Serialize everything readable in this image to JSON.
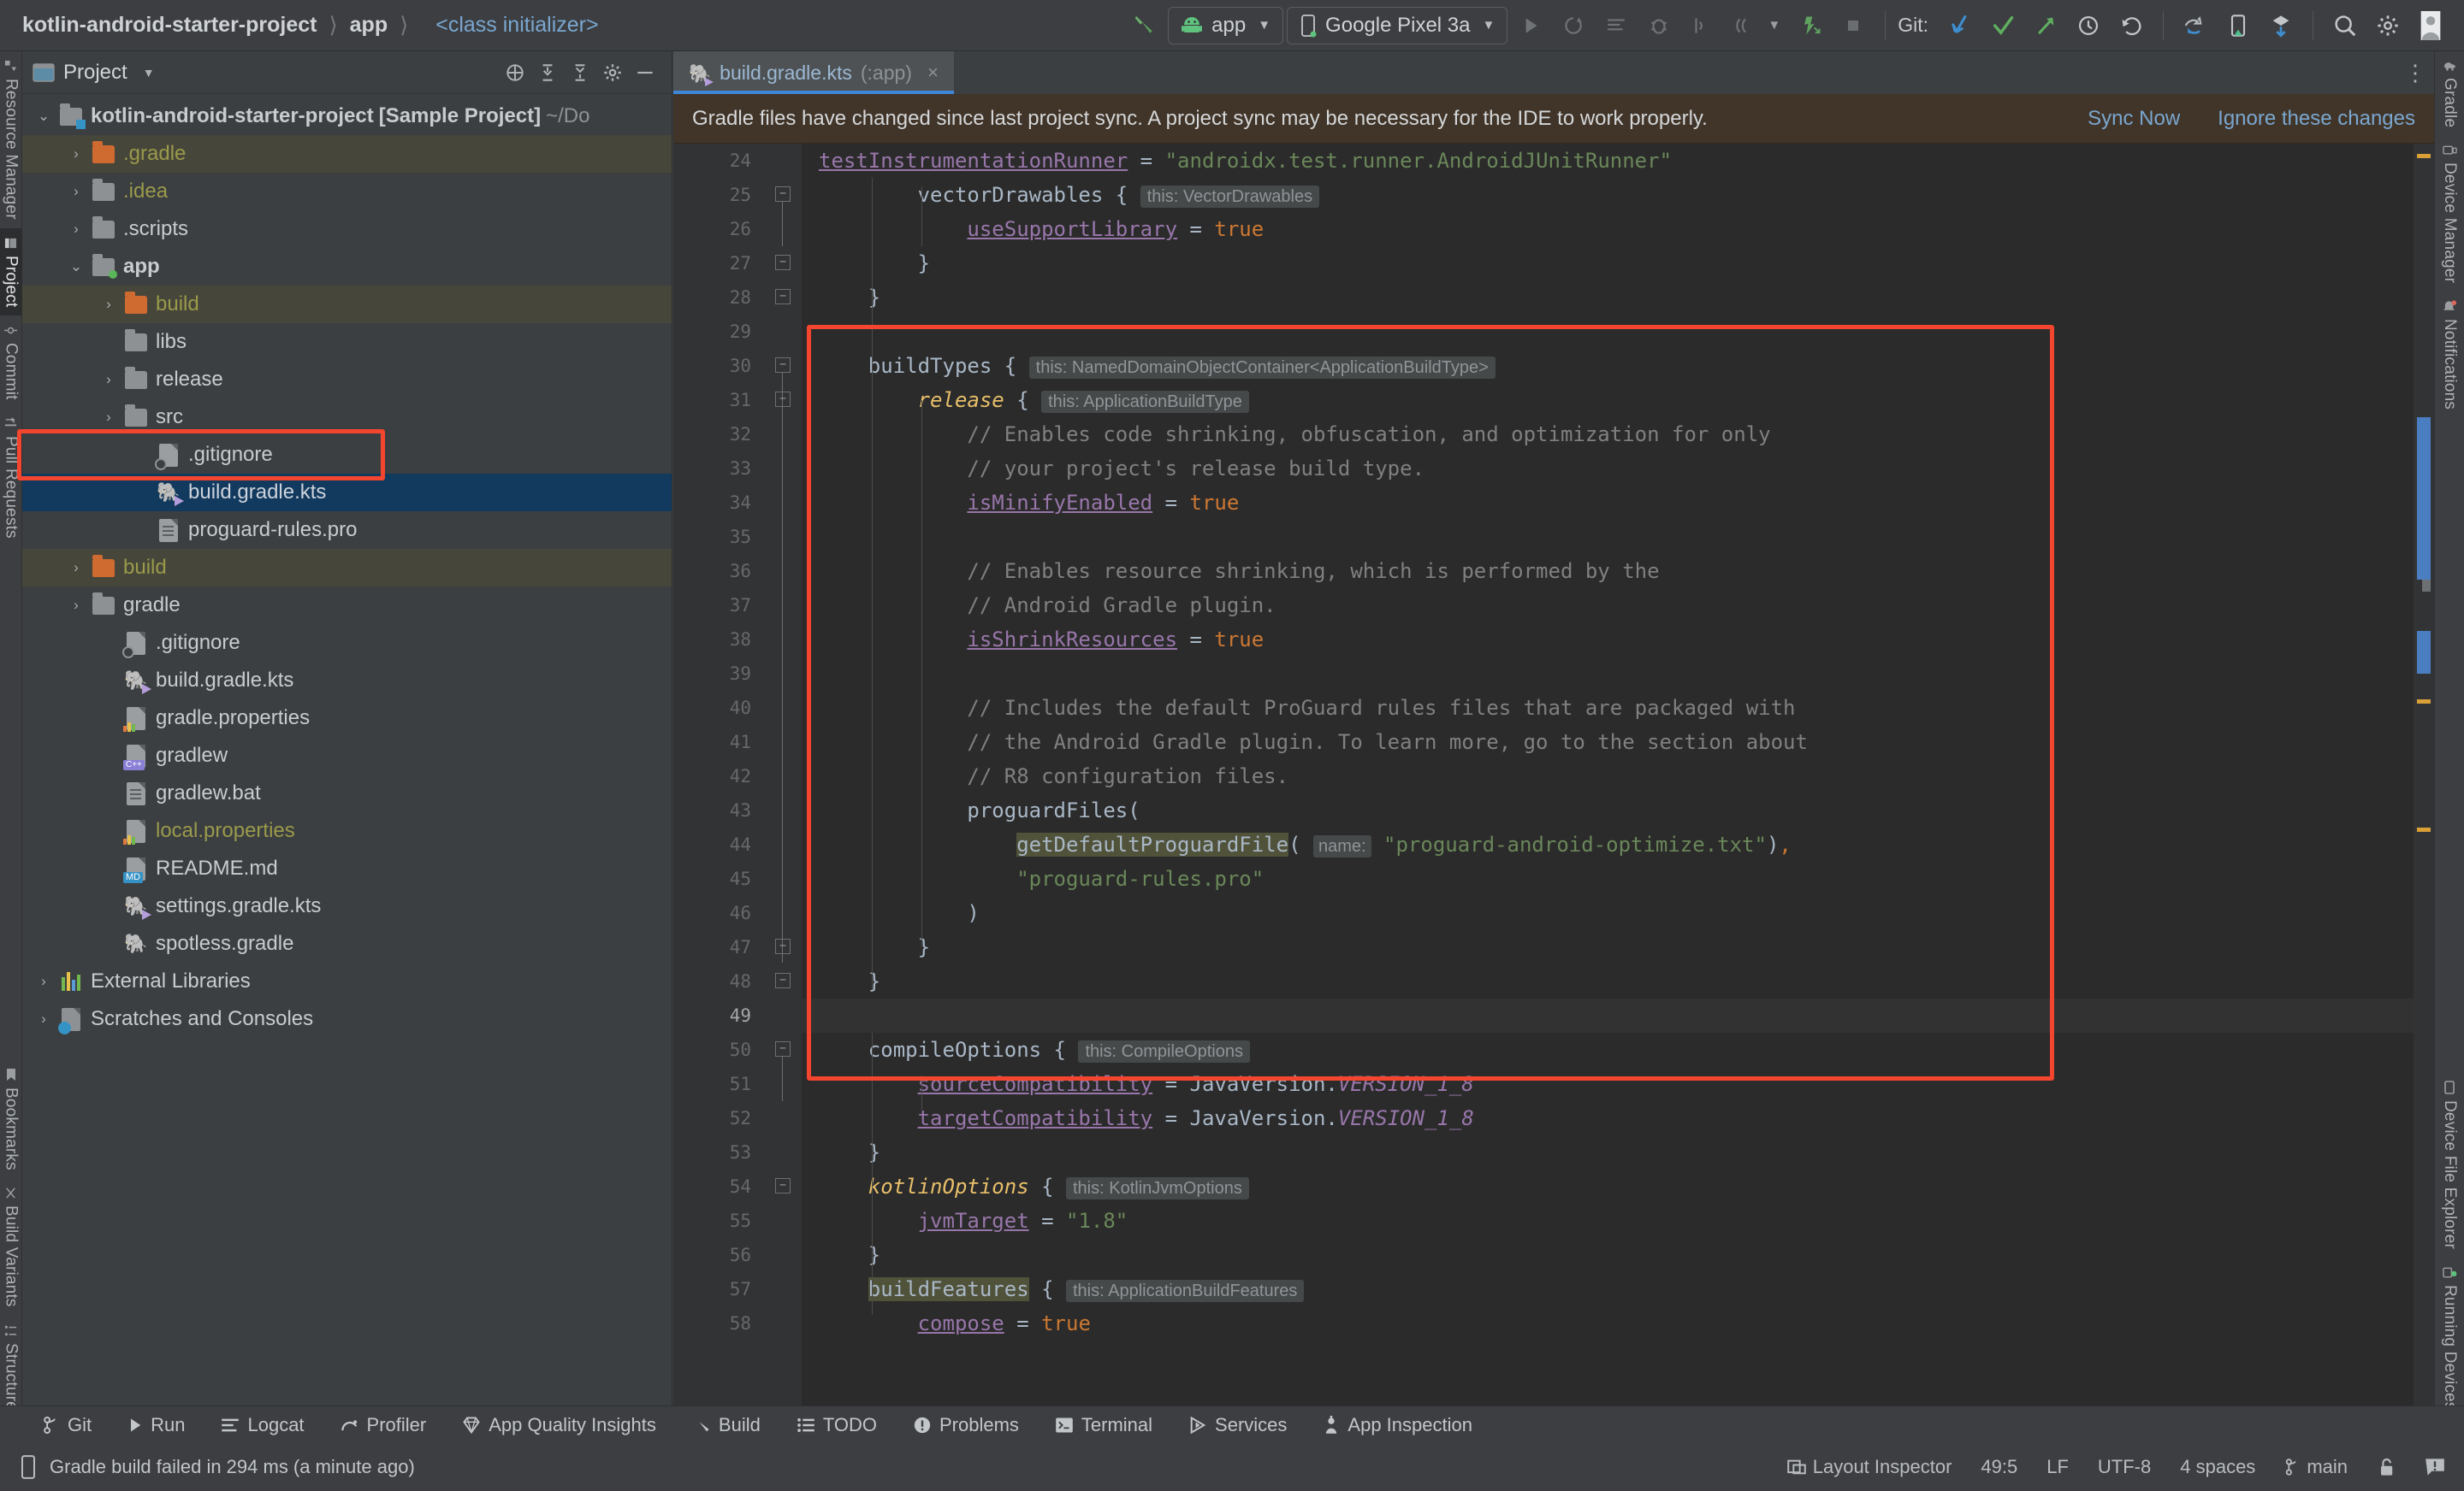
{
  "toolbar": {
    "breadcrumb": [
      "kotlin-android-starter-project",
      "app",
      "<class initializer>"
    ],
    "hammer_icon": "build-hammer-icon",
    "run_config": {
      "label": "app",
      "icon": "android-robot-icon",
      "caret": "▼"
    },
    "device_selector": {
      "label": "Google Pixel 3a",
      "icon": "phone-icon",
      "caret": "▼"
    },
    "run_icon": "run-icon",
    "rerun_icon": "apply-changes-icon",
    "log_icon": "logcat-icon",
    "debug_icon": "debug-icon",
    "step_icon": "step-icon",
    "coverage_icon": "coverage-icon",
    "more_caret": "▼",
    "profile_icon": "profiler-icon",
    "stop_icon": "stop-icon",
    "git_label": "Git:",
    "git_update_icon": "git-update-icon",
    "git_commit_icon": "git-commit-check-icon",
    "git_push_icon": "git-push-icon",
    "git_history_icon": "git-history-icon",
    "git_rollback_icon": "git-rollback-icon",
    "sync_gradle_icon": "sync-gradle-icon",
    "avd_icon": "avd-manager-icon",
    "sdk_icon": "sdk-manager-icon",
    "search_icon": "search-everywhere-icon",
    "settings_icon": "settings-gear-icon",
    "account_icon": "user-account-icon"
  },
  "left_rail": [
    {
      "label": "Resource Manager",
      "icon": "resource-manager-icon",
      "active": false
    },
    {
      "label": "Project",
      "icon": "project-icon",
      "active": true
    },
    {
      "label": "Commit",
      "icon": "commit-icon",
      "active": false
    },
    {
      "label": "Pull Requests",
      "icon": "pull-requests-icon",
      "active": false
    },
    {
      "label": "Bookmarks",
      "icon": "bookmarks-icon",
      "active": false
    },
    {
      "label": "Build Variants",
      "icon": "build-variants-icon",
      "active": false
    },
    {
      "label": "Structure",
      "icon": "structure-icon",
      "active": false
    }
  ],
  "right_rail_top": [
    {
      "label": "Gradle",
      "icon": "gradle-elephant-icon"
    },
    {
      "label": "Device Manager",
      "icon": "device-manager-icon"
    },
    {
      "label": "Notifications",
      "icon": "notifications-icon"
    }
  ],
  "right_rail_bottom": [
    {
      "label": "Device File Explorer",
      "icon": "device-file-explorer-icon"
    },
    {
      "label": "Running Devices",
      "icon": "running-devices-icon"
    }
  ],
  "project_panel": {
    "title": "Project",
    "caret": "▼",
    "buttons": [
      "locate-icon",
      "expand-all-icon",
      "collapse-all-icon",
      "settings-icon",
      "hide-icon"
    ],
    "tree": [
      {
        "indent": 0,
        "arrow": "⌄",
        "label": "kotlin-android-starter-project",
        "suffix": " [Sample Project] ",
        "path": "~/Do",
        "icon": "module-folder-icon",
        "style": "root"
      },
      {
        "indent": 1,
        "arrow": "›",
        "label": ".gradle",
        "icon": "excluded-folder-icon",
        "style": "excluded"
      },
      {
        "indent": 1,
        "arrow": "›",
        "label": ".idea",
        "icon": "folder-icon",
        "style": "idea"
      },
      {
        "indent": 1,
        "arrow": "›",
        "label": ".scripts",
        "icon": "folder-icon",
        "style": "normal"
      },
      {
        "indent": 1,
        "arrow": "⌄",
        "label": "app",
        "icon": "module-folder-icon",
        "style": "module"
      },
      {
        "indent": 2,
        "arrow": "›",
        "label": "build",
        "icon": "excluded-folder-icon",
        "style": "excluded"
      },
      {
        "indent": 2,
        "arrow": "",
        "label": "libs",
        "icon": "folder-icon",
        "style": "normal"
      },
      {
        "indent": 2,
        "arrow": "›",
        "label": "release",
        "icon": "folder-icon",
        "style": "normal"
      },
      {
        "indent": 2,
        "arrow": "›",
        "label": "src",
        "icon": "folder-icon",
        "style": "normal"
      },
      {
        "indent": 3,
        "arrow": "",
        "label": ".gitignore",
        "icon": "gitignore-file-icon",
        "style": "normal"
      },
      {
        "indent": 3,
        "arrow": "",
        "label": "build.gradle.kts",
        "icon": "gradle-kts-file-icon",
        "style": "selected"
      },
      {
        "indent": 3,
        "arrow": "",
        "label": "proguard-rules.pro",
        "icon": "text-file-icon",
        "style": "normal"
      },
      {
        "indent": 1,
        "arrow": "›",
        "label": "build",
        "icon": "excluded-folder-icon",
        "style": "excluded"
      },
      {
        "indent": 1,
        "arrow": "›",
        "label": "gradle",
        "icon": "folder-icon",
        "style": "normal"
      },
      {
        "indent": 2,
        "arrow": "",
        "label": ".gitignore",
        "icon": "gitignore-file-icon",
        "style": "normal"
      },
      {
        "indent": 2,
        "arrow": "",
        "label": "build.gradle.kts",
        "icon": "gradle-kts-file-icon",
        "style": "normal"
      },
      {
        "indent": 2,
        "arrow": "",
        "label": "gradle.properties",
        "icon": "properties-file-icon",
        "style": "normal"
      },
      {
        "indent": 2,
        "arrow": "",
        "label": "gradlew",
        "icon": "cpp-file-icon",
        "style": "normal"
      },
      {
        "indent": 2,
        "arrow": "",
        "label": "gradlew.bat",
        "icon": "text-file-icon",
        "style": "normal"
      },
      {
        "indent": 2,
        "arrow": "",
        "label": "local.properties",
        "icon": "properties-file-icon",
        "style": "excluded"
      },
      {
        "indent": 2,
        "arrow": "",
        "label": "README.md",
        "icon": "markdown-file-icon",
        "style": "normal"
      },
      {
        "indent": 2,
        "arrow": "",
        "label": "settings.gradle.kts",
        "icon": "gradle-kts-file-icon",
        "style": "normal"
      },
      {
        "indent": 2,
        "arrow": "",
        "label": "spotless.gradle",
        "icon": "gradle-file-icon",
        "style": "normal"
      },
      {
        "indent": 0,
        "arrow": "›",
        "label": "External Libraries",
        "icon": "external-libraries-icon",
        "style": "normal"
      },
      {
        "indent": 0,
        "arrow": "›",
        "label": "Scratches and Consoles",
        "icon": "scratches-icon",
        "style": "normal"
      }
    ]
  },
  "editor": {
    "tab": {
      "label": "build.gradle.kts",
      "module": "(:app)",
      "icon": "gradle-kts-file-icon",
      "close": "×"
    },
    "tabbar_more": "⋮",
    "banner": {
      "message": "Gradle files have changed since last project sync. A project sync may be necessary for the IDE to work properly.",
      "sync_link": "Sync Now",
      "ignore_link": "Ignore these changes"
    },
    "first_line_number": 24,
    "lines": [
      {
        "n": 24,
        "text": "partial-line"
      },
      {
        "n": 25,
        "text": "        vectorDrawables {  this: VectorDrawables"
      },
      {
        "n": 26,
        "text": "            useSupportLibrary = true"
      },
      {
        "n": 27,
        "text": "        }"
      },
      {
        "n": 28,
        "text": "    }"
      },
      {
        "n": 29,
        "text": ""
      },
      {
        "n": 30,
        "text": "    buildTypes {  this: NamedDomainObjectContainer<ApplicationBuildType>"
      },
      {
        "n": 31,
        "text": "        release {  this: ApplicationBuildType"
      },
      {
        "n": 32,
        "text": "            // Enables code shrinking, obfuscation, and optimization for only"
      },
      {
        "n": 33,
        "text": "            // your project's release build type."
      },
      {
        "n": 34,
        "text": "            isMinifyEnabled = true"
      },
      {
        "n": 35,
        "text": ""
      },
      {
        "n": 36,
        "text": "            // Enables resource shrinking, which is performed by the"
      },
      {
        "n": 37,
        "text": "            // Android Gradle plugin."
      },
      {
        "n": 38,
        "text": "            isShrinkResources = true"
      },
      {
        "n": 39,
        "text": ""
      },
      {
        "n": 40,
        "text": "            // Includes the default ProGuard rules files that are packaged with"
      },
      {
        "n": 41,
        "text": "            // the Android Gradle plugin. To learn more, go to the section about"
      },
      {
        "n": 42,
        "text": "            // R8 configuration files."
      },
      {
        "n": 43,
        "text": "            proguardFiles("
      },
      {
        "n": 44,
        "text": "                getDefaultProguardFile( name: \"proguard-android-optimize.txt\"),"
      },
      {
        "n": 45,
        "text": "                \"proguard-rules.pro\""
      },
      {
        "n": 46,
        "text": "            )"
      },
      {
        "n": 47,
        "text": "        }"
      },
      {
        "n": 48,
        "text": "    }"
      },
      {
        "n": 49,
        "text": ""
      },
      {
        "n": 50,
        "text": "    compileOptions {  this: CompileOptions"
      },
      {
        "n": 51,
        "text": "        sourceCompatibility = JavaVersion.VERSION_1_8"
      },
      {
        "n": 52,
        "text": "        targetCompatibility = JavaVersion.VERSION_1_8"
      },
      {
        "n": 53,
        "text": "    }"
      },
      {
        "n": 54,
        "text": "    kotlinOptions {  this: KotlinJvmOptions"
      },
      {
        "n": 55,
        "text": "        jvmTarget = \"1.8\""
      },
      {
        "n": 56,
        "text": "    }"
      },
      {
        "n": 57,
        "text": "    buildFeatures {  this: ApplicationBuildFeatures"
      },
      {
        "n": 58,
        "text": "        compose = true"
      }
    ],
    "tokens": {
      "line24_prefix": "testInstrumentationRunner",
      "line24_eq": " = ",
      "line24_val": "\"androidx.test.runner.And",
      "vector_drawables": "vectorDrawables",
      "hint_vector": "this: VectorDrawables",
      "use_support": "useSupportLibrary",
      "true": "true",
      "build_types": "buildTypes",
      "hint_buildtypes": "this: NamedDomainObjectContainer<ApplicationBuildType>",
      "release": "release",
      "hint_release": "this: ApplicationBuildType",
      "comment1": "// Enables code shrinking, obfuscation, and optimization for only",
      "comment2": "// your project's release build type.",
      "is_minify": "isMinifyEnabled",
      "comment3": "// Enables resource shrinking, which is performed by the",
      "comment4": "// Android Gradle plugin.",
      "is_shrink": "isShrinkResources",
      "comment5": "// Includes the default ProGuard rules files that are packaged with",
      "comment6": "// the Android Gradle plugin. To learn more, go to the section about",
      "comment7": "// R8 configuration files.",
      "proguard_files": "proguardFiles(",
      "get_default": "getDefaultProguardFile",
      "hint_name": "name:",
      "str_optimize": "\"proguard-android-optimize.txt\"",
      "str_rules": "\"proguard-rules.pro\"",
      "compile_options": "compileOptions",
      "hint_compile": "this: CompileOptions",
      "source_compat": "sourceCompatibility",
      "target_compat": "targetCompatibility",
      "java_version": "JavaVersion.",
      "version_1_8": "VERSION_1_8",
      "kotlin_options": "kotlinOptions",
      "hint_kotlin": "this: KotlinJvmOptions",
      "jvm_target": "jvmTarget",
      "str_18": "\"1.8\"",
      "build_features": "buildFeatures",
      "hint_features": "this: ApplicationBuildFeatures",
      "compose": "compose"
    }
  },
  "tool_windows": [
    {
      "label": "Git",
      "icon": "git-branch-icon"
    },
    {
      "label": "Run",
      "icon": "run-icon"
    },
    {
      "label": "Logcat",
      "icon": "logcat-icon"
    },
    {
      "label": "Profiler",
      "icon": "profiler-icon"
    },
    {
      "label": "App Quality Insights",
      "icon": "diamond-icon"
    },
    {
      "label": "Build",
      "icon": "build-hammer-icon"
    },
    {
      "label": "TODO",
      "icon": "todo-list-icon"
    },
    {
      "label": "Problems",
      "icon": "problems-icon"
    },
    {
      "label": "Terminal",
      "icon": "terminal-icon"
    },
    {
      "label": "Services",
      "icon": "services-icon"
    },
    {
      "label": "App Inspection",
      "icon": "app-inspection-icon"
    }
  ],
  "status_bar": {
    "message": "Gradle build failed in 294 ms (a minute ago)",
    "message_icon": "device-icon",
    "layout_inspector": "Layout Inspector",
    "layout_inspector_icon": "layout-inspector-icon",
    "caret_position": "49:5",
    "line_separator": "LF",
    "encoding": "UTF-8",
    "indent": "4 spaces",
    "branch": "main",
    "branch_icon": "git-branch-icon",
    "lock_icon": "unlocked-icon",
    "notification_icon": "notification-balloon-icon"
  },
  "colors": {
    "accent_blue": "#3e86d6",
    "link_blue": "#7aa7d0",
    "selection": "#123a5e",
    "annotation_red": "#f4452e",
    "banner_bg": "#413529",
    "editor_bg": "#2b2b2b",
    "excluded_text": "#9a9a4b"
  }
}
